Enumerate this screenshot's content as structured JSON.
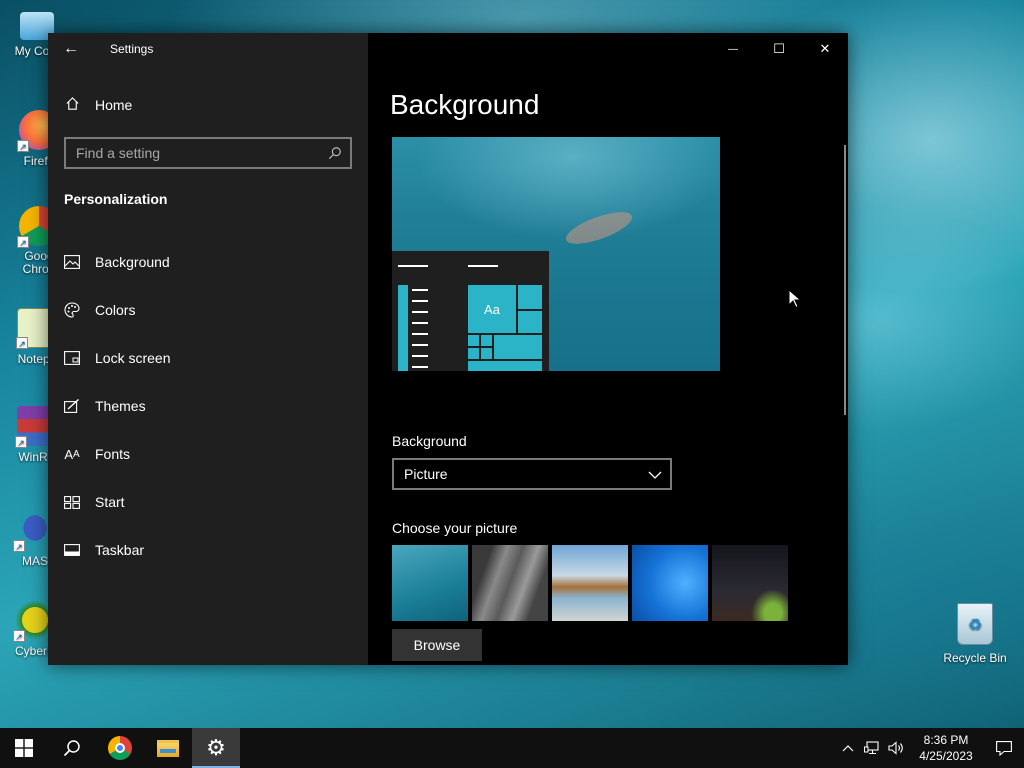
{
  "desktop": {
    "icons": [
      {
        "label": "My Com",
        "icon": "computer-icon"
      },
      {
        "label": "Firefo",
        "icon": "firefox-icon"
      },
      {
        "label": "Goog\nChron",
        "icon": "chrome-icon"
      },
      {
        "label": "Notepa",
        "icon": "notepad-icon"
      },
      {
        "label": "WinRA",
        "icon": "winrar-icon"
      },
      {
        "label": "MAS",
        "icon": "mas-icon"
      },
      {
        "label": "CyberE",
        "icon": "cyber-icon"
      }
    ],
    "recycle_bin_label": "Recycle Bin"
  },
  "window": {
    "title": "Settings",
    "back_glyph": "←",
    "minimize_glyph": "—",
    "maximize_glyph": "☐",
    "close_glyph": "✕"
  },
  "sidebar": {
    "home_label": "Home",
    "search_placeholder": "Find a setting",
    "section_title": "Personalization",
    "items": [
      {
        "label": "Background",
        "icon": "picture-icon"
      },
      {
        "label": "Colors",
        "icon": "palette-icon"
      },
      {
        "label": "Lock screen",
        "icon": "lock-screen-icon"
      },
      {
        "label": "Themes",
        "icon": "themes-icon"
      },
      {
        "label": "Fonts",
        "icon": "fonts-icon"
      },
      {
        "label": "Start",
        "icon": "start-icon"
      },
      {
        "label": "Taskbar",
        "icon": "taskbar-icon"
      }
    ]
  },
  "main": {
    "page_title": "Background",
    "preview_tile_text": "Aa",
    "background_label": "Background",
    "background_value": "Picture",
    "choose_picture_label": "Choose your picture",
    "browse_label": "Browse"
  },
  "taskbar": {
    "apps": [
      "start-icon",
      "search-icon",
      "chrome-icon",
      "file-explorer-icon",
      "settings-icon"
    ],
    "active_app": "settings-icon",
    "time": "8:36 PM",
    "date": "4/25/2023"
  },
  "colors": {
    "accent": "#2bb3c8",
    "sidebar_bg": "#1f1f1f",
    "content_bg": "#000000",
    "taskbar_bg": "#101010"
  }
}
